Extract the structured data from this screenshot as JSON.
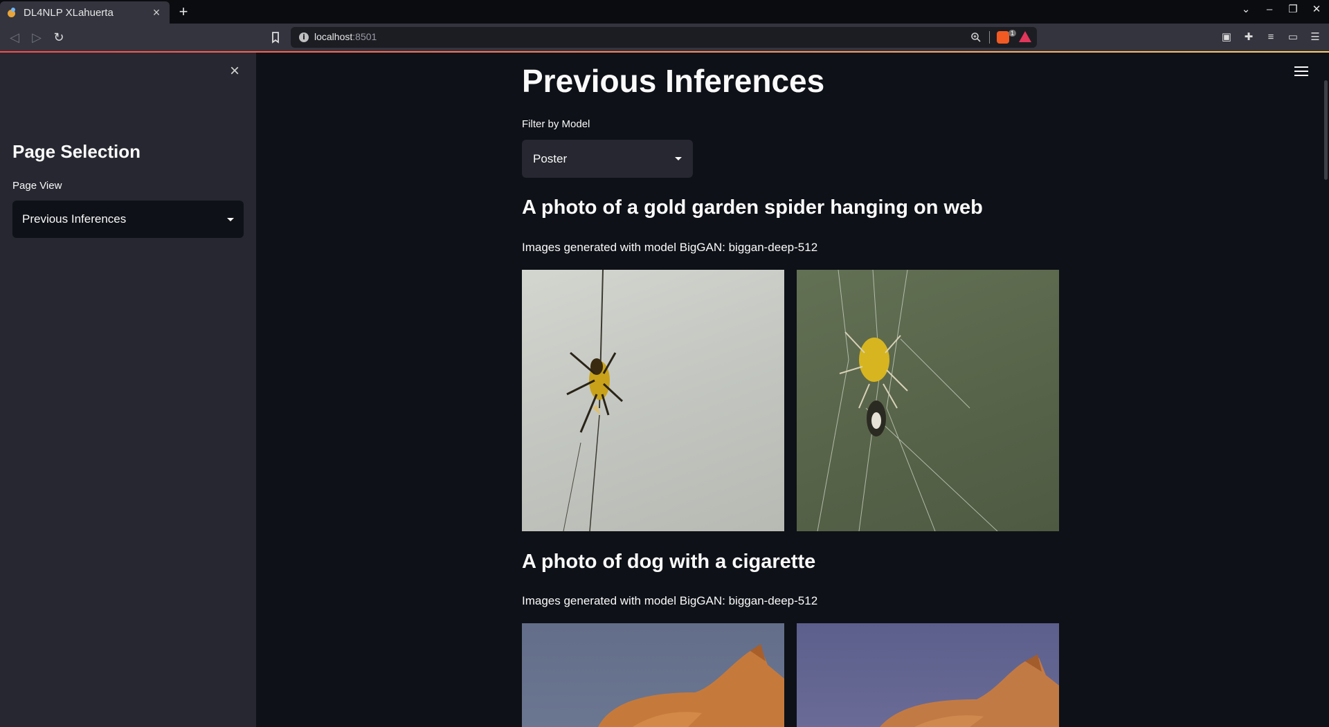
{
  "browser": {
    "tab_title": "DL4NLP XLahuerta",
    "tab_close": "×",
    "new_tab": "+",
    "url_host": "localhost",
    "url_port": ":8501",
    "brave_badge": "1"
  },
  "sidebar": {
    "close_glyph": "×",
    "title": "Page Selection",
    "page_view_label": "Page View",
    "page_view_value": "Previous Inferences"
  },
  "main": {
    "title": "Previous Inferences",
    "filter_label": "Filter by Model",
    "filter_value": "Poster",
    "inferences": [
      {
        "prompt": "A photo of a gold garden spider hanging on web",
        "model_text": "Images generated with model BigGAN: biggan-deep-512"
      },
      {
        "prompt": "A photo of dog with a cigarette",
        "model_text": "Images generated with model BigGAN: biggan-deep-512"
      }
    ]
  },
  "colors": {
    "app_bg": "#0e1117",
    "sidebar_bg": "#262730",
    "accent": "#ff4b4b"
  }
}
